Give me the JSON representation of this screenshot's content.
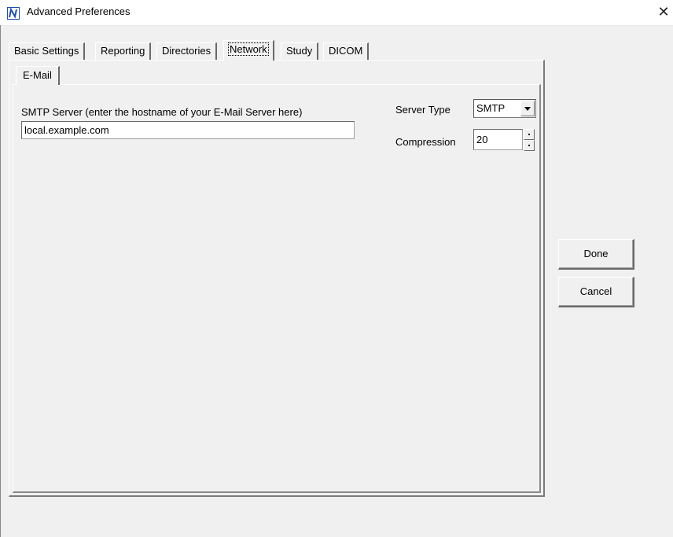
{
  "window": {
    "title": "Advanced Preferences",
    "close_glyph": "✕"
  },
  "icons": {
    "app": "app-logo-icon",
    "close": "close-icon",
    "dropdown": "chevron-down-icon",
    "spin": "spin-arrows-icon"
  },
  "tabs": [
    {
      "label": "Basic Settings"
    },
    {
      "label": "Reporting"
    },
    {
      "label": "Directories"
    },
    {
      "label": "Network"
    },
    {
      "label": "Study"
    },
    {
      "label": "DICOM"
    }
  ],
  "active_tab": "Network",
  "subtabs": [
    {
      "label": "E-Mail"
    }
  ],
  "email": {
    "smtp_label": "SMTP Server (enter the hostname of your E-Mail Server here)",
    "smtp_value": "local.example.com",
    "server_type_label": "Server Type",
    "server_type_value": "SMTP",
    "compression_label": "Compression",
    "compression_value": "20"
  },
  "buttons": {
    "done": "Done",
    "cancel": "Cancel"
  }
}
